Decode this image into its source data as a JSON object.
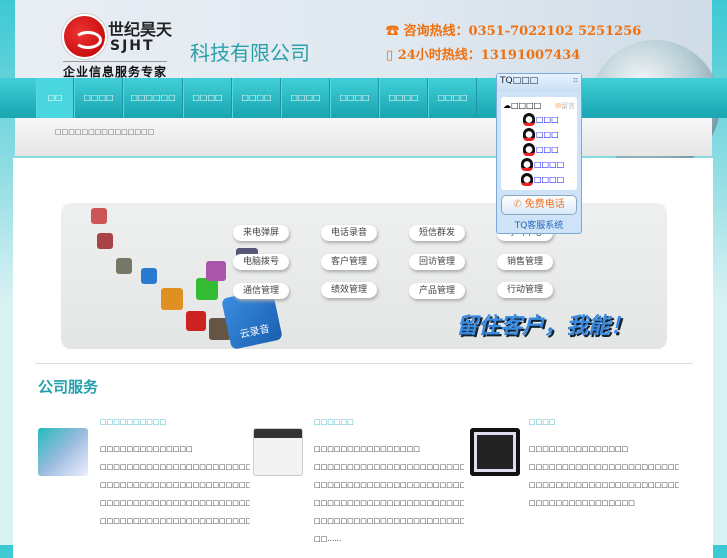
{
  "header": {
    "brand_cn": "世纪昊天",
    "brand_en": "SJHT",
    "tagline": "企业信息服务专家",
    "company": "科技有限公司",
    "hotline": "咨询热线：0351-7022102  5251256",
    "hotline24": "24小时热线：13191007434"
  },
  "nav": [
    "□□",
    "□□□□",
    "□□□□□□",
    "□□□□",
    "□□□□",
    "□□□□",
    "□□□□",
    "□□□□",
    "□□□□"
  ],
  "breadcrumb": "□□□□□□□□□□□□□□□",
  "banner": {
    "features": [
      "来电弹屏",
      "电话录音",
      "短信群发",
      "呼叫中心",
      "电脑拨号",
      "客户管理",
      "回访管理",
      "销售管理",
      "通信管理",
      "绩效管理",
      "产品管理",
      "行动管理"
    ],
    "cloud": "云录音",
    "slogan": "留住客户，我能！"
  },
  "section_title": "公司服务",
  "services": [
    {
      "title": "□□□□□□□□□□",
      "lines": [
        "□□□□□□□□□□□□□□",
        "□□□□□□□□□□□□□□□□□□□□□□□□□□□□□□",
        "□□□□□□□□□□□□□□□□□□□□□□□□□□□□□□",
        "□□□□□□□□□□□□□□□□□□□□□□□□□□□□□□",
        "□□□□□□□□□□□□□□□□□□□□□□□□"
      ]
    },
    {
      "title": "□□□□□□",
      "lines": [
        "□□□□□□□□□□□□□□□□",
        "□□□□□□□□□□□□□□□□□□□□□□□□□□□□□□",
        "□□□□□□□□□□□□□□□□□□□□□□□□□□□□□□",
        "□□□□□□□□□□□□□□□□□□□□□□□□□□□□□□",
        "□□□□□□□□□□□□□□□□□□□□□□□□□",
        "□□……"
      ]
    },
    {
      "title": "□□□□",
      "lines": [
        "□□□□□□□□□□□□□□□",
        "□□□□□□□□□□□□□□□□□□□□□□□□□□□□□□",
        "□□□□□□□□□□□□□□□□□□□□□□□□□□□□□□",
        "□□□□□□□□□□□□□□□□"
      ]
    }
  ],
  "tq": {
    "title": "TQ□□□",
    "group": "□□□□",
    "message": "留言",
    "agents": [
      "□□□",
      "□□□",
      "□□□",
      "□□□□",
      "□□□□"
    ],
    "free_call": "免费电话",
    "system": "TQ客服系统"
  }
}
